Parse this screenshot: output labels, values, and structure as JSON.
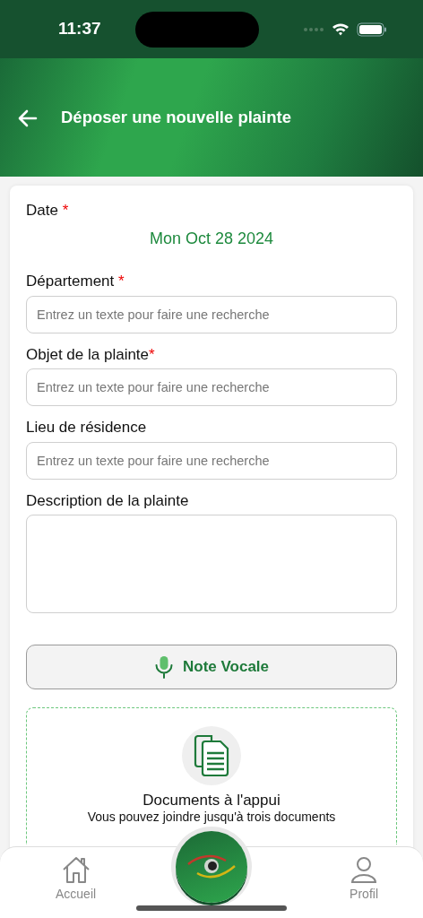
{
  "status_bar": {
    "time": "11:37"
  },
  "header": {
    "title": "Déposer une nouvelle plainte"
  },
  "form": {
    "fields": [
      {
        "kind": "date",
        "label": "Date",
        "mark": " *",
        "value": "Mon Oct 28 2024"
      },
      {
        "kind": "search",
        "label": "Département",
        "mark": " *",
        "placeholder": "Entrez un texte pour faire une recherche"
      },
      {
        "kind": "search",
        "label": "Objet de la plainte",
        "mark": "*",
        "placeholder": "Entrez un texte pour faire une recherche"
      },
      {
        "kind": "search",
        "label": "Lieu de résidence",
        "placeholder": "Entrez un texte pour faire une recherche"
      },
      {
        "kind": "textarea",
        "label": "Description de la plainte"
      }
    ],
    "voice_button": {
      "label": "Note Vocale"
    },
    "documents": {
      "title": "Documents à l'appui",
      "subtitle": "Vous pouvez joindre jusqu'à trois documents"
    }
  },
  "bottom_nav": {
    "items": [
      {
        "kind": "home",
        "label": "Accueil"
      },
      {
        "kind": "logo"
      },
      {
        "kind": "profile",
        "label": "Profil"
      }
    ]
  }
}
